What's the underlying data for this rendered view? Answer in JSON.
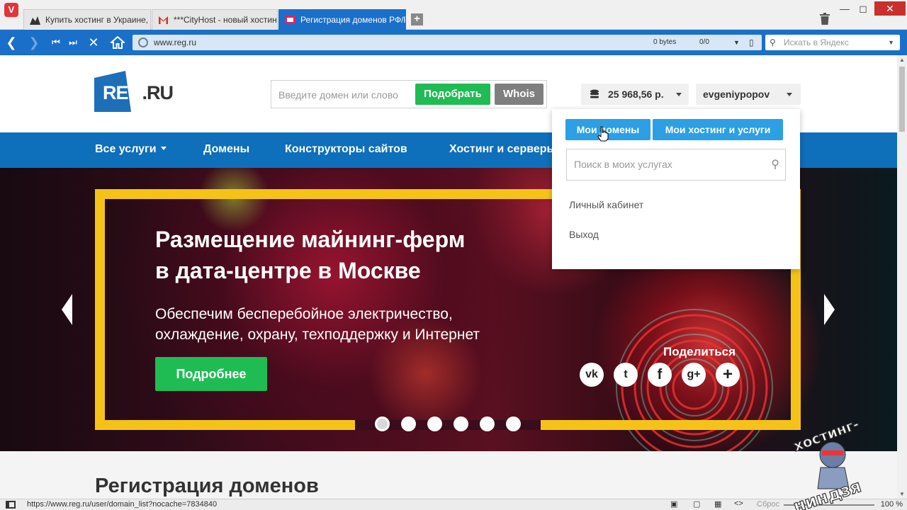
{
  "browser": {
    "tabs": [
      {
        "title": "Купить хостинг в Украине, E",
        "active": false,
        "favicon": "chart-favicon"
      },
      {
        "title": "***CityHost - новый хостинг",
        "active": false,
        "favicon": "gmail-favicon"
      },
      {
        "title": "Регистрация доменов РФ/R",
        "active": true,
        "favicon": "regru-favicon"
      }
    ],
    "new_tab_label": "+",
    "url": "www.reg.ru",
    "bytes": "0 bytes",
    "counter": "0/0",
    "search_placeholder": "Искать в Яндекс"
  },
  "site": {
    "logo_main": "REG",
    "logo_ru": ".RU",
    "domain_placeholder": "Введите домен или слово",
    "pick_button": "Подобрать",
    "whois_button": "Whois",
    "balance": "25 968,56 р.",
    "username": "evgeniypopov",
    "menu": [
      "Все услуги",
      "Домены",
      "Конструкторы сайтов",
      "Хостинг и серверы"
    ],
    "hero": {
      "title": "Размещение майнинг-ферм\nв дата-центре в Москве",
      "subtitle": "Обеспечим бесперебойное электричество,\nохлаждение, охрану, техподдержку и Интернет",
      "button": "Подробнее",
      "share_label": "Поделиться",
      "share_icons": [
        "vk-icon",
        "twitter-icon",
        "facebook-icon",
        "google-plus-icon",
        "plus-icon"
      ],
      "share_glyphs": [
        "vk",
        "t",
        "f",
        "g+",
        "+"
      ]
    },
    "section_title": "Регистрация доменов",
    "dropdown": {
      "my_domains": "Мои домены",
      "my_hosting": "Мои хостинг и услуги",
      "search_placeholder": "Поиск в моих услугах",
      "cabinet": "Личный кабинет",
      "logout": "Выход"
    }
  },
  "status": {
    "link_url": "https://www.reg.ru/user/domain_list?nocache=7834840",
    "reset_label": "Сброс",
    "zoom": "100 %"
  },
  "watermark_text": "хостинг-ниндзя",
  "colors": {
    "browser_accent": "#1a6fc9",
    "site_menu": "#0e6fbb",
    "green": "#1fbc54",
    "frame_yellow": "#f5c318",
    "dropdown_button": "#2c9fe5"
  }
}
